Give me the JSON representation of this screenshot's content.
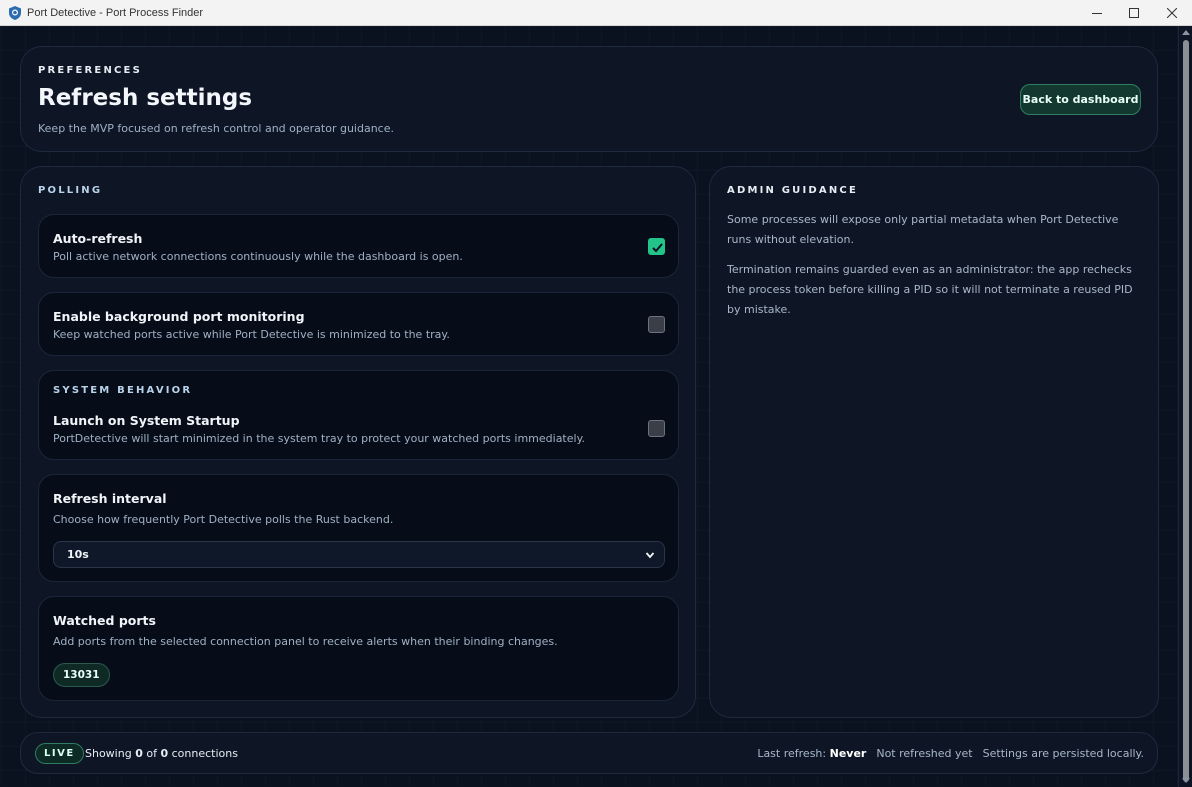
{
  "window": {
    "title": "Port Detective - Port Process Finder",
    "controls": [
      "minimize",
      "maximize",
      "close"
    ]
  },
  "header": {
    "eyebrow": "PREFERENCES",
    "title": "Refresh settings",
    "subtitle": "Keep the MVP focused on refresh control and operator guidance.",
    "back_button_label": "Back to dashboard"
  },
  "polling": {
    "section_label": "POLLING",
    "auto_refresh": {
      "title": "Auto-refresh",
      "description": "Poll active network connections continuously while the dashboard is open.",
      "checked": true
    },
    "background_monitoring": {
      "title": "Enable background port monitoring",
      "description": "Keep watched ports active while Port Detective is minimized to the tray.",
      "checked": false
    },
    "system_behavior": {
      "section_label": "SYSTEM BEHAVIOR",
      "title": "Launch on System Startup",
      "description": "PortDetective will start minimized in the system tray to protect your watched ports immediately.",
      "checked": false
    },
    "refresh_interval": {
      "title": "Refresh interval",
      "description": "Choose how frequently Port Detective polls the Rust backend.",
      "selected": "10s"
    },
    "watched_ports": {
      "title": "Watched ports",
      "description": "Add ports from the selected connection panel to receive alerts when their binding changes.",
      "ports": [
        "13031"
      ]
    }
  },
  "admin": {
    "section_label": "ADMIN GUIDANCE",
    "paragraphs": [
      "Some processes will expose only partial metadata when Port Detective runs without elevation.",
      "Termination remains guarded even as an administrator: the app rechecks the process token before killing a PID so it will not terminate a reused PID by mistake."
    ]
  },
  "footer": {
    "live_badge": "LIVE",
    "showing_prefix": "Showing",
    "shown_count": "0",
    "of_word": "of",
    "total_count": "0",
    "connections_word": "connections",
    "last_refresh_label": "Last refresh:",
    "last_refresh_value": "Never",
    "refresh_status": "Not refreshed yet",
    "persist_note": "Settings are persisted locally."
  },
  "colors": {
    "accent": "#23c48a",
    "background": "#0b1220",
    "panel": "#0e1626"
  }
}
